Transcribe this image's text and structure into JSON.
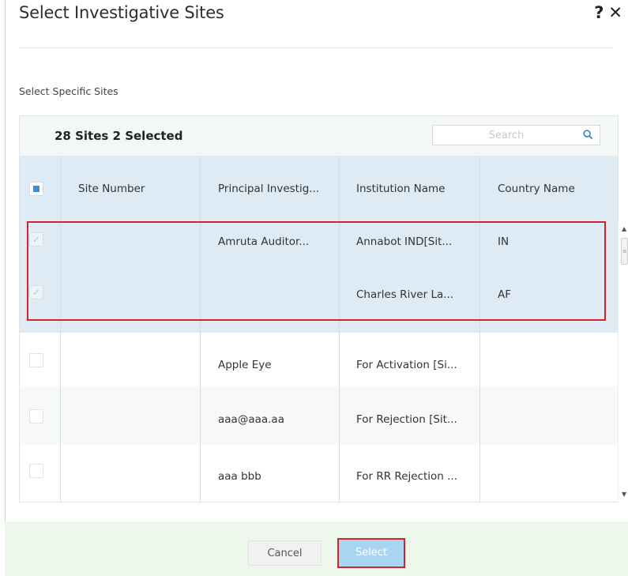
{
  "dialog": {
    "title": "Select Investigative Sites",
    "help_icon": "?",
    "close_icon": "✕",
    "subtitle": "Select Specific Sites"
  },
  "grid": {
    "summary": "28 Sites 2 Selected",
    "search": {
      "placeholder": "Search",
      "value": ""
    },
    "columns": [
      "Site Number",
      "Principal Investig...",
      "Institution Name",
      "Country Name"
    ],
    "rows": [
      {
        "checked": true,
        "site_number": "",
        "pi": "Amruta Auditor...",
        "institution": "Annabot IND[Sit...",
        "country": "IN"
      },
      {
        "checked": true,
        "site_number": "",
        "pi": "",
        "institution": "Charles River La...",
        "country": "AF"
      },
      {
        "checked": false,
        "site_number": "",
        "pi": "Apple Eye",
        "institution": "For Activation [Si...",
        "country": ""
      },
      {
        "checked": false,
        "site_number": "",
        "pi": "aaa@aaa.aa",
        "institution": "For Rejection [Sit...",
        "country": ""
      },
      {
        "checked": false,
        "site_number": "",
        "pi": "aaa bbb",
        "institution": "For RR Rejection ...",
        "country": ""
      }
    ]
  },
  "footer": {
    "cancel_label": "Cancel",
    "select_label": "Select"
  },
  "colors": {
    "header_bg": "#deeaf4",
    "selected_row_bg": "#deeaf4",
    "highlight_border": "#d2232a",
    "select_button": "#a9d5f3",
    "footer_bg": "#eef7ec"
  }
}
